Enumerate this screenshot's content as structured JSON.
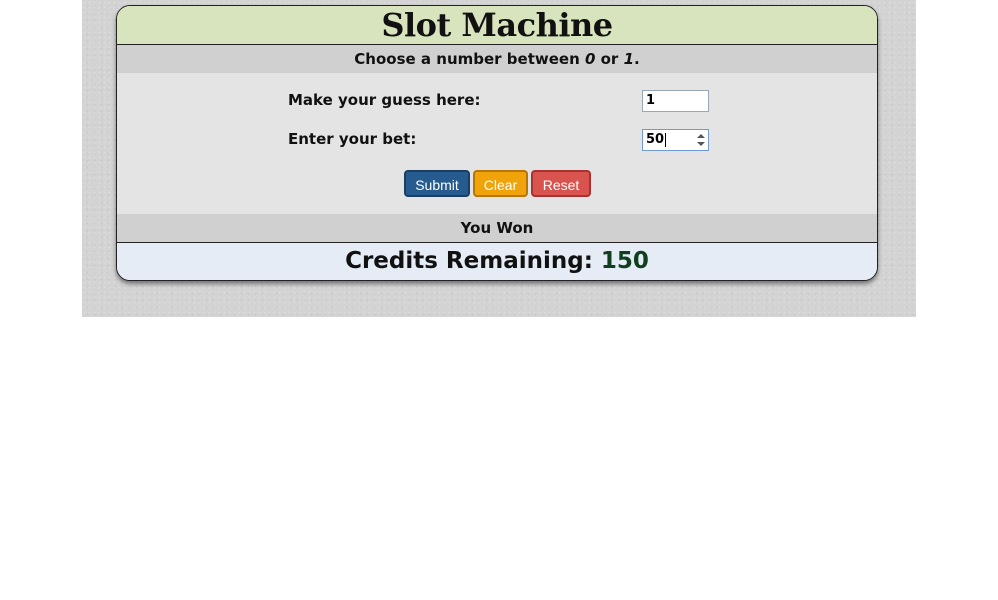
{
  "machine": {
    "title": "Slot Machine",
    "instruction": {
      "prefix": "Choose a number between ",
      "low": "0",
      "middle": " or ",
      "high": "1",
      "suffix": "."
    },
    "guess": {
      "label": "Make your guess here:",
      "value": "1"
    },
    "bet": {
      "label": "Enter your bet:",
      "value": "50"
    },
    "buttons": {
      "submit": "Submit",
      "clear": "Clear",
      "reset": "Reset"
    },
    "result": "You Won",
    "credits": {
      "label": "Credits Remaining: ",
      "value": "150"
    }
  },
  "colors": {
    "title_bg": "#d7e4bd",
    "credits_bg": "#e5ecf6",
    "submit": "#255b8e",
    "clear": "#f0a30a",
    "reset": "#d9534f",
    "credits_value": "#0f3f1f"
  }
}
